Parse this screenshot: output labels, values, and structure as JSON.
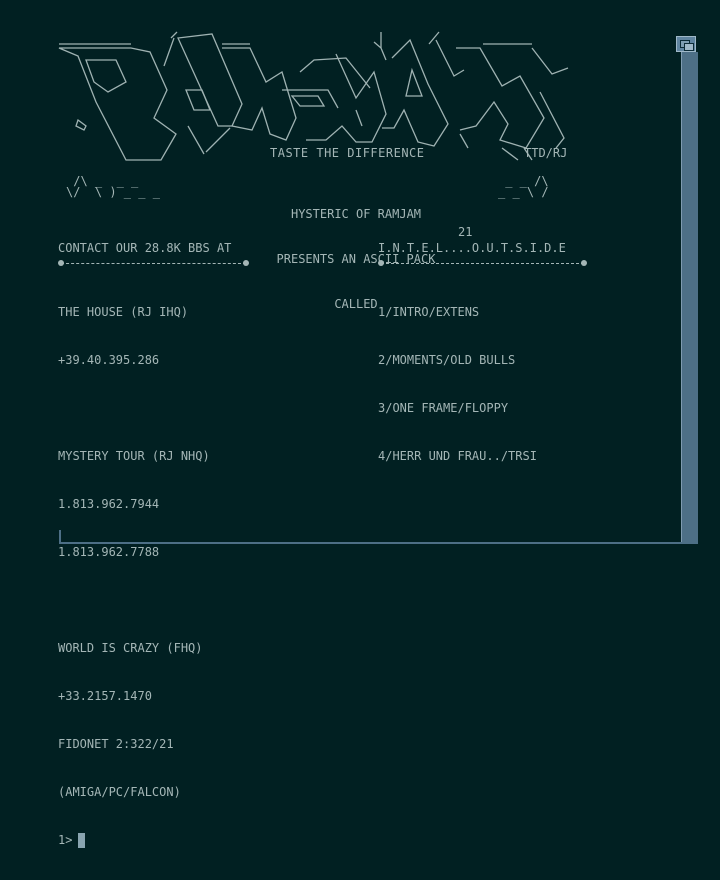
{
  "screen": {
    "tagline": "TASTE THE DIFFERENCE",
    "signature": "TTD/RJ",
    "art_left": " /\\ _  _ _\n\\/  \\ ) _ _ _",
    "art_right": " _ _ /\\\n_ _ \\ /",
    "presents": {
      "line1": "HYSTERIC OF RAMJAM",
      "line2": "PRESENTS AN ASCII PACK",
      "line3": "CALLED"
    },
    "pack_number": "21",
    "pack_name": "I.N.T.E.L....O.U.T.S.I.D.E",
    "contact_header": "CONTACT OUR 28.8K BBS AT",
    "bbs": [
      {
        "name": "THE HOUSE (RJ IHQ)",
        "numbers": [
          "+39.40.395.286"
        ]
      },
      {
        "name": "MYSTERY TOUR (RJ NHQ)",
        "numbers": [
          "1.813.962.7944",
          "1.813.962.7788"
        ]
      },
      {
        "name": "WORLD IS CRAZY (FHQ)",
        "numbers": [
          "+33.2157.1470",
          "FIDONET 2:322/21",
          "(AMIGA/PC/FALCON)"
        ]
      }
    ],
    "pack_contents": [
      "1/INTRO/EXTENS",
      "2/MOMENTS/OLD BULLS",
      "3/ONE FRAME/FLOPPY",
      "4/HERR UND FRAU../TRSI"
    ],
    "prompt": "1>"
  },
  "colors": {
    "background": "#012022",
    "text": "#a4b6b6",
    "window_border": "#4d6f86"
  },
  "icons": {
    "depth_gadget": "depth-gadget-icon",
    "cursor": "text-cursor"
  }
}
